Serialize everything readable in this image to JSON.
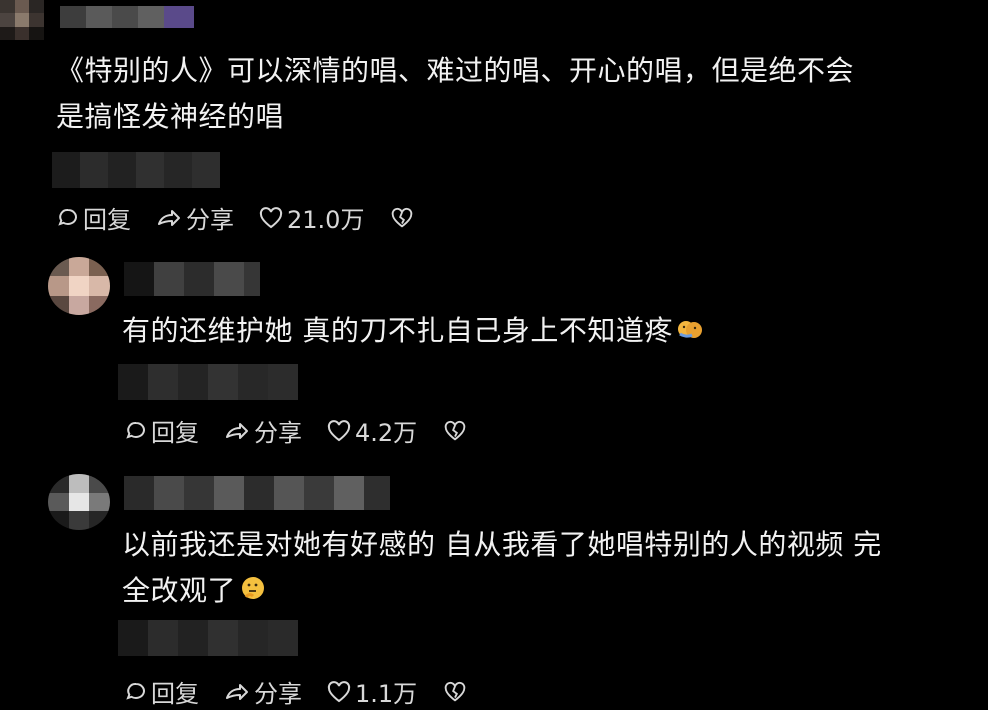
{
  "comments": [
    {
      "text_line1": "《特别的人》可以深情的唱、难过的唱、开心的唱，但是绝不会",
      "text_line2": "是搞怪发神经的唱",
      "reply_label": "回复",
      "share_label": "分享",
      "likes": "21.0万"
    },
    {
      "text_line1": "有的还维护她 真的刀不扎自己身上不知道疼",
      "reply_label": "回复",
      "share_label": "分享",
      "likes": "4.2万"
    },
    {
      "text_line1": "以前我还是对她有好感的 自从我看了她唱特别的人的视频 完",
      "text_line2": "全改观了",
      "reply_label": "回复",
      "share_label": "分享",
      "likes": "1.1万"
    }
  ]
}
